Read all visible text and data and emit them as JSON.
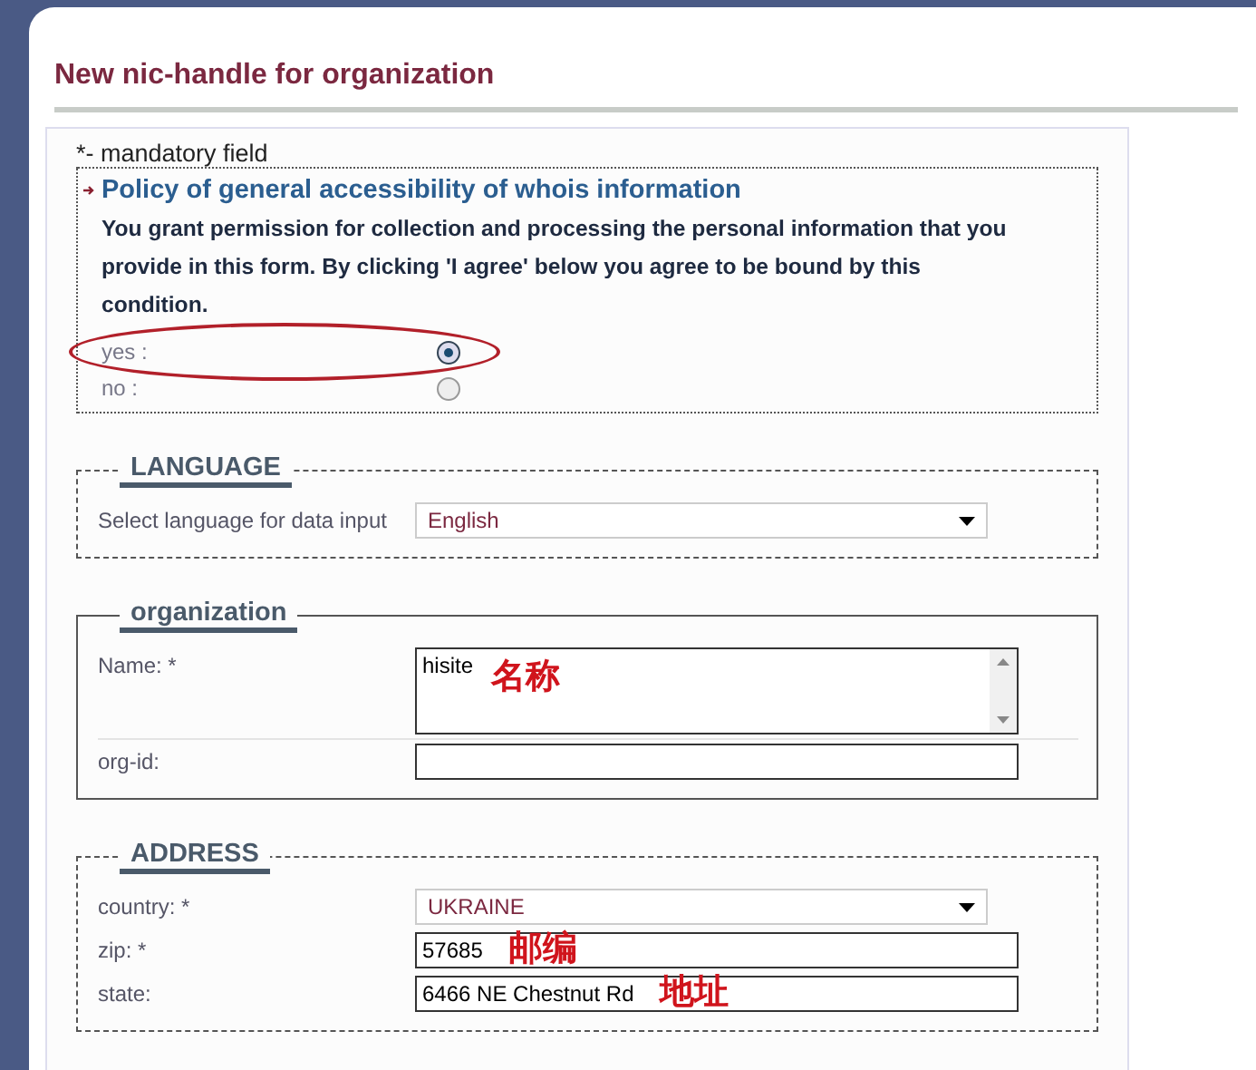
{
  "title": "New nic-handle for organization",
  "mandatory_note": "*- mandatory field",
  "policy": {
    "heading": "Policy of general accessibility of whois information",
    "text": "You grant permission for collection and processing the personal information that you provide in this form. By clicking 'I agree' below you agree to be bound by this condition.",
    "options": [
      {
        "label": "yes :",
        "selected": true,
        "circled": true
      },
      {
        "label": "no :",
        "selected": false,
        "circled": false
      }
    ]
  },
  "sections": [
    {
      "legend": "LANGUAGE",
      "kind": "dashed",
      "fields": [
        {
          "kind": "select",
          "label": "Select language for data input",
          "value": "English"
        }
      ]
    },
    {
      "legend": "organization",
      "kind": "solid",
      "fields": [
        {
          "kind": "textarea",
          "label": "Name: *",
          "value": "hisite",
          "annotation": "名称"
        },
        {
          "kind": "text",
          "label": "org-id:"
        }
      ]
    },
    {
      "legend": "ADDRESS",
      "kind": "dashed",
      "fields": [
        {
          "kind": "select",
          "label": "country: *",
          "value": "UKRAINE"
        },
        {
          "kind": "text",
          "label": "zip: *",
          "value": "57685",
          "annotation": "邮编"
        },
        {
          "kind": "text",
          "label": "state:",
          "value": "6466 NE Chestnut Rd",
          "annotation": "地址"
        }
      ]
    }
  ]
}
